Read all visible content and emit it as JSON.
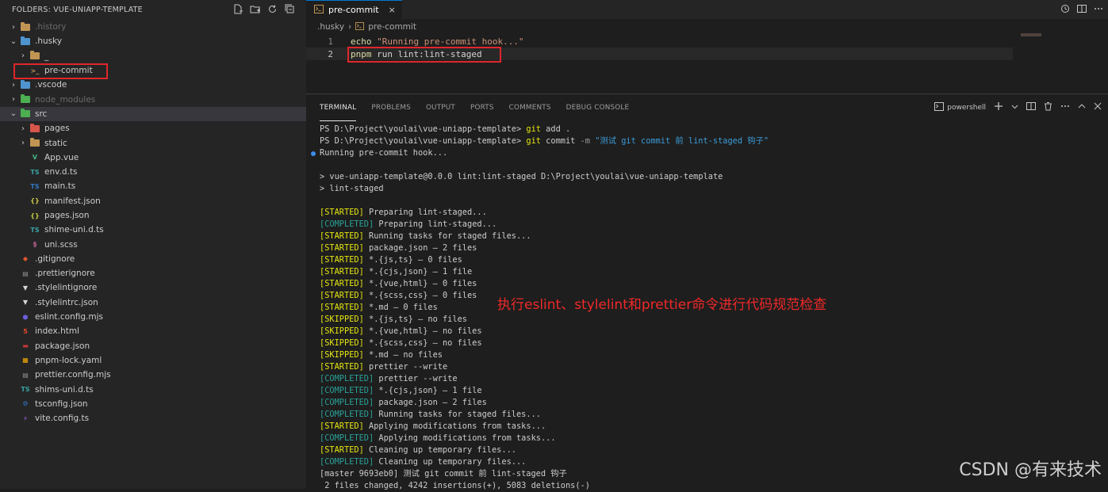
{
  "explorer": {
    "header": "FOLDERS: VUE-UNIAPP-TEMPLATE",
    "items": [
      {
        "label": ".history",
        "chevron": "›",
        "depth": 0,
        "kind": "folder",
        "dim": true
      },
      {
        "label": ".husky",
        "chevron": "⌄",
        "depth": 0,
        "kind": "folder-blue"
      },
      {
        "label": "_",
        "chevron": "›",
        "depth": 1,
        "kind": "folder"
      },
      {
        "label": "pre-commit",
        "chevron": "",
        "depth": 1,
        "kind": "shell"
      },
      {
        "label": ".vscode",
        "chevron": "›",
        "depth": 0,
        "kind": "folder-blue"
      },
      {
        "label": "node_modules",
        "chevron": "›",
        "depth": 0,
        "kind": "folder-green",
        "dim": true
      },
      {
        "label": "src",
        "chevron": "⌄",
        "depth": 0,
        "kind": "folder-green",
        "selected": true
      },
      {
        "label": "pages",
        "chevron": "›",
        "depth": 1,
        "kind": "folder-red"
      },
      {
        "label": "static",
        "chevron": "›",
        "depth": 1,
        "kind": "folder"
      },
      {
        "label": "App.vue",
        "chevron": "",
        "depth": 1,
        "kind": "vue"
      },
      {
        "label": "env.d.ts",
        "chevron": "",
        "depth": 1,
        "kind": "ts"
      },
      {
        "label": "main.ts",
        "chevron": "",
        "depth": 1,
        "kind": "ts-blue"
      },
      {
        "label": "manifest.json",
        "chevron": "",
        "depth": 1,
        "kind": "json"
      },
      {
        "label": "pages.json",
        "chevron": "",
        "depth": 1,
        "kind": "json"
      },
      {
        "label": "shime-uni.d.ts",
        "chevron": "",
        "depth": 1,
        "kind": "ts"
      },
      {
        "label": "uni.scss",
        "chevron": "",
        "depth": 1,
        "kind": "scss"
      },
      {
        "label": ".gitignore",
        "chevron": "",
        "depth": 0,
        "kind": "git"
      },
      {
        "label": ".prettierignore",
        "chevron": "",
        "depth": 0,
        "kind": "prettier"
      },
      {
        "label": ".stylelintignore",
        "chevron": "",
        "depth": 0,
        "kind": "stylelint"
      },
      {
        "label": ".stylelintrc.json",
        "chevron": "",
        "depth": 0,
        "kind": "stylelint"
      },
      {
        "label": "eslint.config.mjs",
        "chevron": "",
        "depth": 0,
        "kind": "eslint"
      },
      {
        "label": "index.html",
        "chevron": "",
        "depth": 0,
        "kind": "html"
      },
      {
        "label": "package.json",
        "chevron": "",
        "depth": 0,
        "kind": "npm"
      },
      {
        "label": "pnpm-lock.yaml",
        "chevron": "",
        "depth": 0,
        "kind": "pnpm"
      },
      {
        "label": "prettier.config.mjs",
        "chevron": "",
        "depth": 0,
        "kind": "prettier"
      },
      {
        "label": "shims-uni.d.ts",
        "chevron": "",
        "depth": 0,
        "kind": "ts"
      },
      {
        "label": "tsconfig.json",
        "chevron": "",
        "depth": 0,
        "kind": "tsconfig"
      },
      {
        "label": "vite.config.ts",
        "chevron": "",
        "depth": 0,
        "kind": "vite"
      }
    ]
  },
  "editor": {
    "tab_label": "pre-commit",
    "tab_close": "×",
    "breadcrumb": [
      ".husky",
      "pre-commit"
    ],
    "breadcrumb_sep": "›",
    "lines": [
      {
        "num": "1",
        "tokens": [
          {
            "t": "echo ",
            "c": "fn"
          },
          {
            "t": "\"Running pre-commit hook...\"",
            "c": "str"
          }
        ]
      },
      {
        "num": "2",
        "tokens": [
          {
            "t": "pnpm",
            "c": "fn"
          },
          {
            "t": " run lint:lint-staged",
            "c": "txt"
          }
        ]
      }
    ]
  },
  "panel": {
    "tabs": [
      "TERMINAL",
      "PROBLEMS",
      "OUTPUT",
      "PORTS",
      "COMMENTS",
      "DEBUG CONSOLE"
    ],
    "active_tab": "TERMINAL",
    "shell_label": "powershell",
    "terminal_lines": [
      [
        {
          "t": "PS D:\\Project\\youlai\\vue-uniapp-template> "
        },
        {
          "t": "git",
          "c": "cmd"
        },
        {
          "t": " add ."
        }
      ],
      [
        {
          "t": "PS D:\\Project\\youlai\\vue-uniapp-template> "
        },
        {
          "t": "git",
          "c": "cmd"
        },
        {
          "t": " commit "
        },
        {
          "t": "-m",
          "c": "dim"
        },
        {
          "t": " \"测试 git commit 前 lint-staged 钩子\"",
          "c": "str"
        }
      ],
      [
        {
          "t": "Running pre-commit hook...",
          "dot": true
        }
      ],
      [
        {
          "t": ""
        }
      ],
      [
        {
          "t": "> vue-uniapp-template@0.0.0 lint:lint-staged D:\\Project\\youlai\\vue-uniapp-template"
        }
      ],
      [
        {
          "t": "> lint-staged"
        }
      ],
      [
        {
          "t": ""
        }
      ],
      [
        {
          "t": "[STARTED]",
          "c": "y"
        },
        {
          "t": " Preparing lint-staged..."
        }
      ],
      [
        {
          "t": "[COMPLETED]",
          "c": "g"
        },
        {
          "t": " Preparing lint-staged..."
        }
      ],
      [
        {
          "t": "[STARTED]",
          "c": "y"
        },
        {
          "t": " Running tasks for staged files..."
        }
      ],
      [
        {
          "t": "[STARTED]",
          "c": "y"
        },
        {
          "t": " package.json — 2 files"
        }
      ],
      [
        {
          "t": "[STARTED]",
          "c": "y"
        },
        {
          "t": " *.{js,ts} — 0 files"
        }
      ],
      [
        {
          "t": "[STARTED]",
          "c": "y"
        },
        {
          "t": " *.{cjs,json} — 1 file"
        }
      ],
      [
        {
          "t": "[STARTED]",
          "c": "y"
        },
        {
          "t": " *.{vue,html} — 0 files"
        }
      ],
      [
        {
          "t": "[STARTED]",
          "c": "y"
        },
        {
          "t": " *.{scss,css} — 0 files"
        }
      ],
      [
        {
          "t": "[STARTED]",
          "c": "y"
        },
        {
          "t": " *.md — 0 files"
        }
      ],
      [
        {
          "t": "[SKIPPED]",
          "c": "y"
        },
        {
          "t": " *.{js,ts} — no files"
        }
      ],
      [
        {
          "t": "[SKIPPED]",
          "c": "y"
        },
        {
          "t": " *.{vue,html} — no files"
        }
      ],
      [
        {
          "t": "[SKIPPED]",
          "c": "y"
        },
        {
          "t": " *.{scss,css} — no files"
        }
      ],
      [
        {
          "t": "[SKIPPED]",
          "c": "y"
        },
        {
          "t": " *.md — no files"
        }
      ],
      [
        {
          "t": "[STARTED]",
          "c": "y"
        },
        {
          "t": " prettier --write"
        }
      ],
      [
        {
          "t": "[COMPLETED]",
          "c": "g"
        },
        {
          "t": " prettier --write"
        }
      ],
      [
        {
          "t": "[COMPLETED]",
          "c": "g"
        },
        {
          "t": " *.{cjs,json} — 1 file"
        }
      ],
      [
        {
          "t": "[COMPLETED]",
          "c": "g"
        },
        {
          "t": " package.json — 2 files"
        }
      ],
      [
        {
          "t": "[COMPLETED]",
          "c": "g"
        },
        {
          "t": " Running tasks for staged files..."
        }
      ],
      [
        {
          "t": "[STARTED]",
          "c": "y"
        },
        {
          "t": " Applying modifications from tasks..."
        }
      ],
      [
        {
          "t": "[COMPLETED]",
          "c": "g"
        },
        {
          "t": " Applying modifications from tasks..."
        }
      ],
      [
        {
          "t": "[STARTED]",
          "c": "y"
        },
        {
          "t": " Cleaning up temporary files..."
        }
      ],
      [
        {
          "t": "[COMPLETED]",
          "c": "g"
        },
        {
          "t": " Cleaning up temporary files..."
        }
      ],
      [
        {
          "t": "[master 9693eb0] 测试 git commit 前 lint-staged 钩子"
        }
      ],
      [
        {
          "t": " 2 files changed, 4242 insertions(+), 5083 deletions(-)"
        }
      ]
    ]
  },
  "annotation": "执行eslint、stylelint和prettier命令进行代码规范检查",
  "watermark": "CSDN @有来技术",
  "colors": {
    "accent": "#0078d4",
    "highlight_box": "#e0262b",
    "started": "#e5e510",
    "completed": "#2aa198",
    "annotation": "#f02828"
  }
}
